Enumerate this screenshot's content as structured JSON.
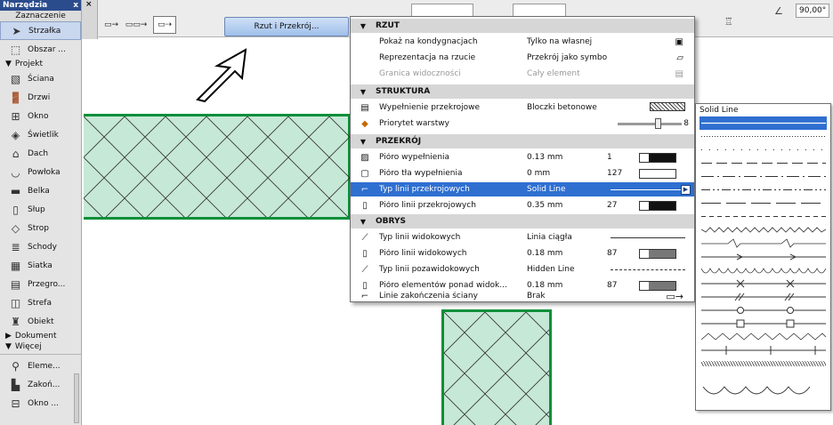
{
  "toolbox": {
    "title": "Narzędzia",
    "close": "x",
    "subtitle": "Zaznaczenie",
    "selection_items": [
      {
        "label": "Strzałka",
        "icon": "arrow-pointer-icon"
      },
      {
        "label": "Obszar ...",
        "icon": "marquee-icon"
      }
    ],
    "section_project": "Projekt",
    "project_items": [
      {
        "label": "Ściana",
        "icon": "wall-icon"
      },
      {
        "label": "Drzwi",
        "icon": "door-icon"
      },
      {
        "label": "Okno",
        "icon": "window-icon"
      },
      {
        "label": "Świetlik",
        "icon": "skylight-icon"
      },
      {
        "label": "Dach",
        "icon": "roof-icon"
      },
      {
        "label": "Powłoka",
        "icon": "shell-icon"
      },
      {
        "label": "Belka",
        "icon": "beam-icon"
      },
      {
        "label": "Słup",
        "icon": "column-icon"
      },
      {
        "label": "Strop",
        "icon": "slab-icon"
      },
      {
        "label": "Schody",
        "icon": "stair-icon"
      },
      {
        "label": "Siatka",
        "icon": "mesh-icon"
      },
      {
        "label": "Przegro...",
        "icon": "curtain-wall-icon"
      },
      {
        "label": "Strefa",
        "icon": "zone-icon"
      },
      {
        "label": "Obiekt",
        "icon": "object-icon"
      }
    ],
    "section_document": "Dokument",
    "section_more": "Więcej",
    "more_items": [
      {
        "label": "Eleme...",
        "icon": "element-icon"
      },
      {
        "label": "Zakoń...",
        "icon": "wall-end-icon"
      },
      {
        "label": "Okno ...",
        "icon": "corner-window-icon"
      }
    ]
  },
  "topbar": {
    "rzut_button": "Rzut i Przekrój...",
    "right_field": "90,00°",
    "hidden_field_1": "",
    "hidden_field_2": ""
  },
  "panel": {
    "sections": {
      "rzut": "RZUT",
      "struktura": "STRUKTURA",
      "przekroj": "PRZEKRÓJ",
      "obrys": "OBRYS"
    },
    "rows": {
      "r1": {
        "name": "Pokaż na kondygnacjach",
        "value": "Tylko na własnej"
      },
      "r2": {
        "name": "Reprezentacja na rzucie",
        "value": "Przekrój jako symbol"
      },
      "r3": {
        "name": "Granica widoczności",
        "value": "Cały element"
      },
      "s1": {
        "name": "Wypełnienie przekrojowe",
        "value": "Bloczki betonowe"
      },
      "s2": {
        "name": "Priorytet warstwy",
        "value": "8"
      },
      "p1": {
        "name": "Pióro wypełnienia",
        "value": "0.13 mm",
        "num": "1"
      },
      "p2": {
        "name": "Pióro tła wypełnienia",
        "value": "0 mm",
        "num": "127"
      },
      "p3": {
        "name": "Typ linii przekrojowych",
        "value": "Solid Line"
      },
      "p4": {
        "name": "Pióro linii przekrojowych",
        "value": "0.35 mm",
        "num": "27"
      },
      "o1": {
        "name": "Typ linii widokowych",
        "value": "Linia ciągła"
      },
      "o2": {
        "name": "Pióro linii widokowych",
        "value": "0.18 mm",
        "num": "87"
      },
      "o3": {
        "name": "Typ linii pozawidokowych",
        "value": "Hidden Line"
      },
      "o4": {
        "name": "Pióro elementów ponad widok...",
        "value": "0.18 mm",
        "num": "87"
      },
      "o5": {
        "name": "Linie zakończenia ściany",
        "value": "Brak"
      }
    }
  },
  "linepopup": {
    "title": "Solid Line"
  }
}
